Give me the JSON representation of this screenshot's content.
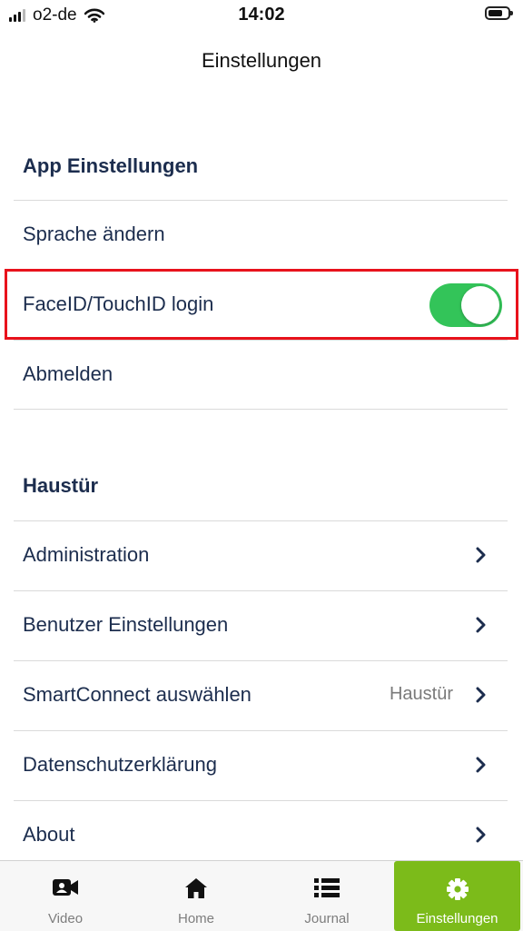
{
  "status_bar": {
    "carrier": "o2-de",
    "time": "14:02",
    "battery_level": 0.75
  },
  "nav": {
    "title": "Einstellungen"
  },
  "app_section": {
    "header": "App Einstellungen",
    "items": [
      {
        "label": "Sprache ändern"
      },
      {
        "label": "FaceID/TouchID login",
        "toggle_on": true
      },
      {
        "label": "Abmelden"
      }
    ]
  },
  "door_section": {
    "header": "Haustür",
    "items": [
      {
        "label": "Administration"
      },
      {
        "label": "Benutzer Einstellungen"
      },
      {
        "label": "SmartConnect auswählen",
        "value": "Haustür"
      },
      {
        "label": "Datenschutzerklärung"
      },
      {
        "label": "About"
      }
    ]
  },
  "tabs": [
    {
      "label": "Video",
      "icon": "video-camera-icon"
    },
    {
      "label": "Home",
      "icon": "house-icon"
    },
    {
      "label": "Journal",
      "icon": "list-icon"
    },
    {
      "label": "Einstellungen",
      "icon": "gear-icon",
      "active": true
    }
  ],
  "colors": {
    "accent": "#7cbb1a",
    "toggle_on": "#33c459",
    "text": "#1c2d4e",
    "highlight": "#e8121c"
  }
}
